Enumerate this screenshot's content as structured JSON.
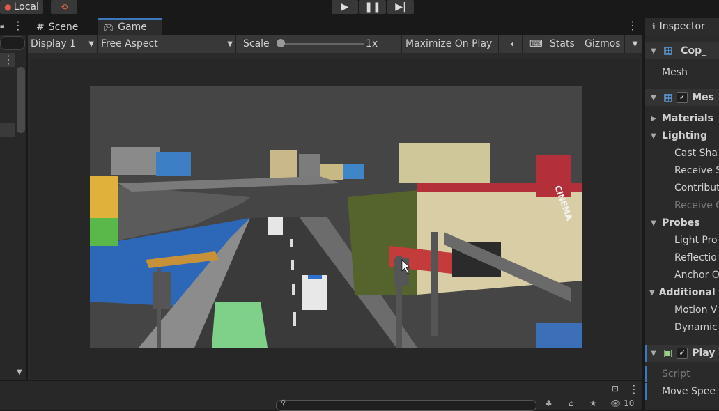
{
  "toolbar": {
    "account_label": "Local",
    "play_icon": "play-icon",
    "pause_icon": "pause-icon",
    "step_icon": "step-icon"
  },
  "game_view": {
    "tabs": [
      {
        "label": "Scene",
        "icon": "hash-icon"
      },
      {
        "label": "Game",
        "icon": "gamepad-icon"
      }
    ],
    "display": "Display 1",
    "aspect": "Free Aspect",
    "scale_label": "Scale",
    "scale_value": "1x",
    "scale_level": 0.0,
    "maximize_label": "Maximize On Play",
    "stats_label": "Stats",
    "gizmos_label": "Gizmos",
    "scene_sign": "CINEMA"
  },
  "inspector": {
    "tab_label": "Inspector",
    "object_name": "Cop_",
    "mesh_label": "Mesh",
    "component_mesh_renderer": "Mes",
    "materials": "Materials",
    "lighting": "Lighting",
    "cast_shadows": "Cast Sha",
    "receive_shadows": "Receive S",
    "contribute_gi": "Contribut",
    "receive_gi": "Receive G",
    "probes": "Probes",
    "light_probes": "Light Pro",
    "reflection_probes": "Reflectio",
    "anchor_override": "Anchor O",
    "additional_settings": "Additional S",
    "motion_vectors": "Motion V",
    "dynamic_occlusion": "Dynamic",
    "component_player": "Play",
    "script_label": "Script",
    "move_speed": "Move Spee"
  },
  "bottom": {
    "hidden_count": "10"
  },
  "colors": {
    "accent": "#3a79bb",
    "panel": "#282828",
    "toolbar": "#383838"
  }
}
